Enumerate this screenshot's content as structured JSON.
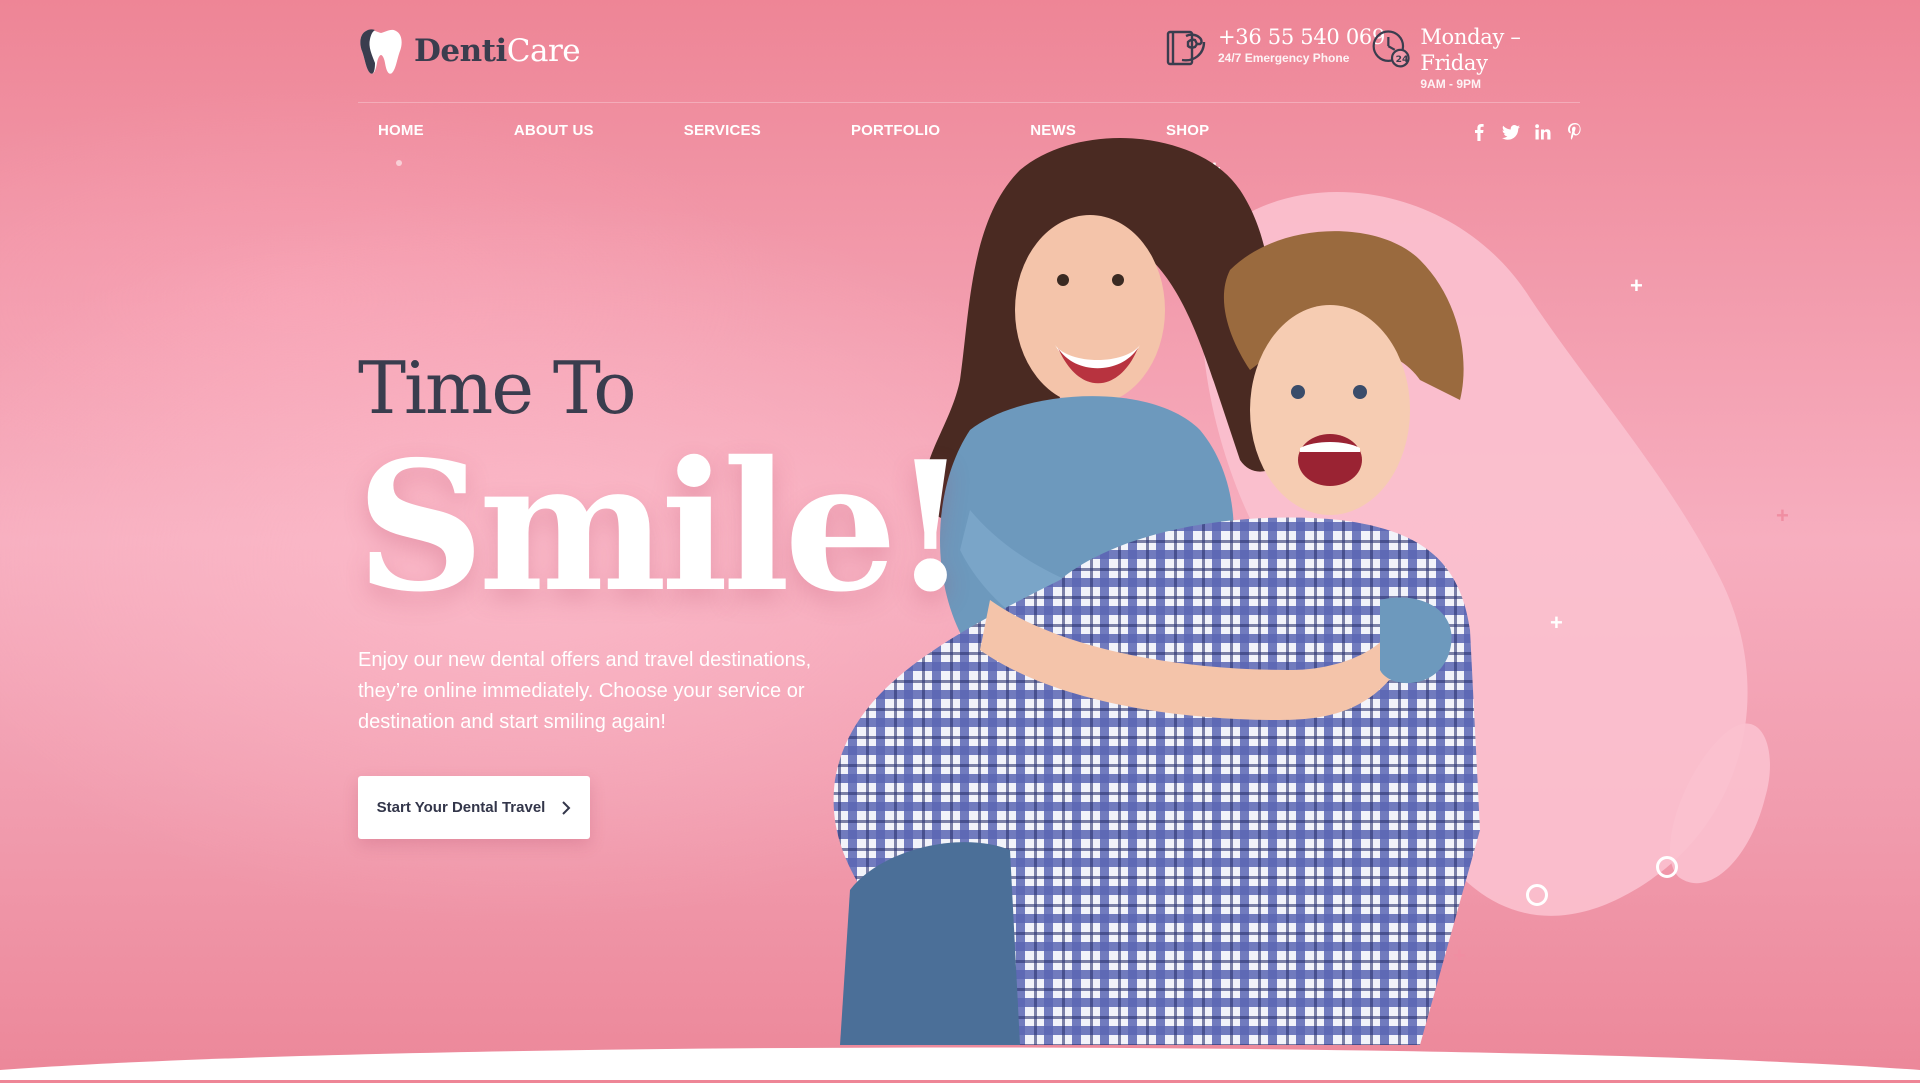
{
  "brand": {
    "name_part1": "Denti",
    "name_part2": "Care",
    "logo_icon": "tooth-icon"
  },
  "contacts": {
    "phone": {
      "icon": "phone-book-icon",
      "value": "+36 55 540 069",
      "caption": "24/7 Emergency Phone"
    },
    "hours": {
      "icon": "clock-24-icon",
      "value": "Monday – Friday",
      "caption": "9AM - 9PM"
    }
  },
  "nav": {
    "items": [
      "HOME",
      "ABOUT US",
      "SERVICES",
      "PORTFOLIO",
      "NEWS",
      "SHOP"
    ],
    "active": "HOME"
  },
  "social": [
    {
      "icon": "facebook-icon",
      "glyph": "f"
    },
    {
      "icon": "twitter-icon",
      "glyph": "t"
    },
    {
      "icon": "linkedin-icon",
      "glyph": "in"
    },
    {
      "icon": "pinterest-icon",
      "glyph": "p"
    }
  ],
  "hero": {
    "pre_title": "Time To",
    "title": "Smile!",
    "description": "Enjoy our new dental offers and travel destinations, they’re online immediately. Choose your service or destination and start smiling again!",
    "cta_label": "Start Your Dental Travel",
    "cta_icon": "chevron-right-icon"
  },
  "colors": {
    "background": "#f29aab",
    "heading_dark": "#3a3d4e",
    "white": "#ffffff"
  }
}
